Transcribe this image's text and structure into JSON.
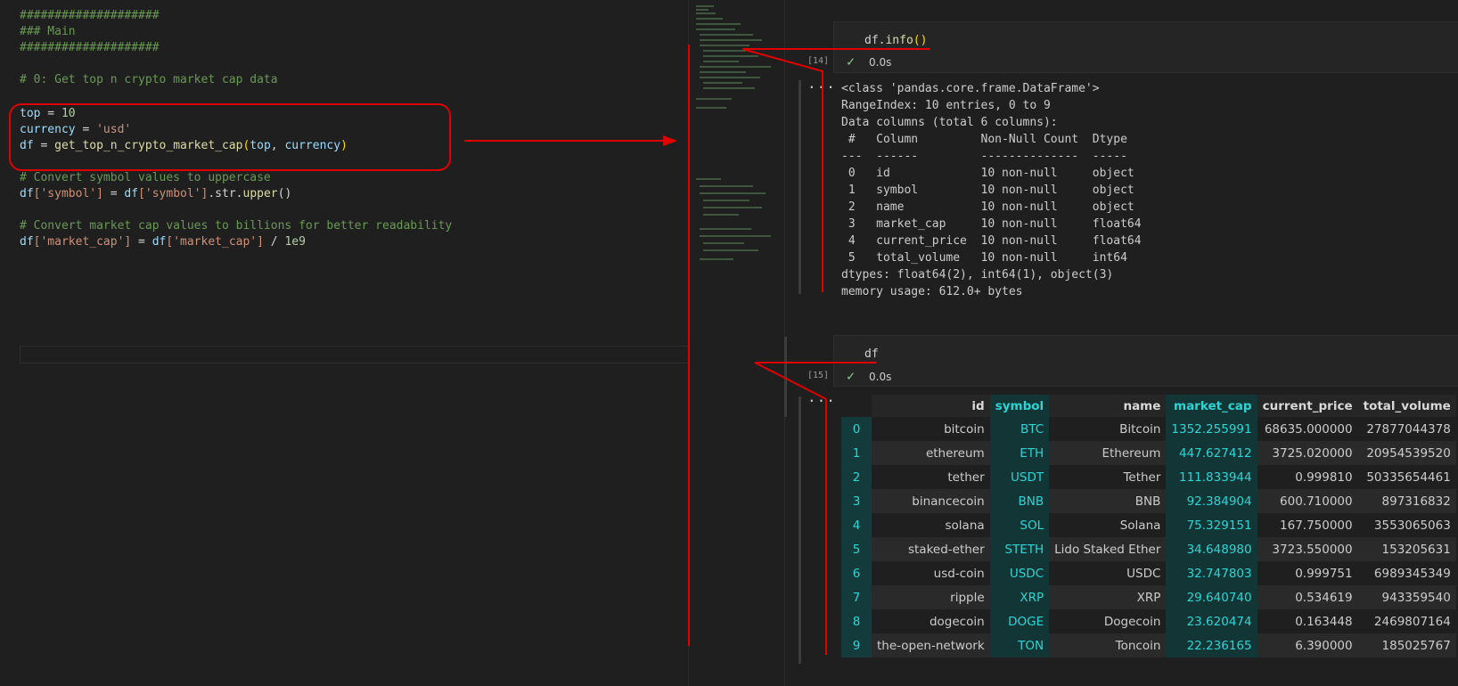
{
  "editor": {
    "lines": {
      "hash1": "####################",
      "main": "### Main",
      "hash2": "####################",
      "c0": "# 0: Get top n crypto market cap data",
      "top_var": "top",
      "top_eq": " = ",
      "top_val": "10",
      "cur_var": "currency",
      "cur_eq": " = ",
      "cur_val": "'usd'",
      "df_var": "df",
      "df_eq": " = ",
      "df_fn": "get_top_n_crypto_market_cap",
      "df_args_open": "(",
      "df_arg1": "top",
      "df_sep": ", ",
      "df_arg2": "currency",
      "df_args_close": ")",
      "c1": "# Convert symbol values to uppercase",
      "l1_a": "df",
      "l1_b": "['symbol']",
      "l1_c": " = ",
      "l1_d": "df",
      "l1_e": "['symbol']",
      "l1_f": ".str.",
      "l1_g": "upper",
      "l1_h": "()",
      "c2": "# Convert market cap values to billions for better readability",
      "l2_a": "df",
      "l2_b": "['market_cap']",
      "l2_c": " = ",
      "l2_d": "df",
      "l2_e": "['market_cap']",
      "l2_f": " / ",
      "l2_g": "1e9"
    }
  },
  "notebook": {
    "cell14": {
      "code_a": "df.",
      "code_b": "info",
      "code_c": "()",
      "exec": "[14]",
      "time": "0.0s",
      "ellipsis": "...",
      "output": "<class 'pandas.core.frame.DataFrame'>\nRangeIndex: 10 entries, 0 to 9\nData columns (total 6 columns):\n #   Column         Non-Null Count  Dtype  \n---  ------         --------------  -----  \n 0   id             10 non-null     object \n 1   symbol         10 non-null     object \n 2   name           10 non-null     object \n 3   market_cap     10 non-null     float64\n 4   current_price  10 non-null     float64\n 5   total_volume   10 non-null     int64  \ndtypes: float64(2), int64(1), object(3)\nmemory usage: 612.0+ bytes"
    },
    "cell15": {
      "code": "df",
      "exec": "[15]",
      "time": "0.0s",
      "ellipsis": "..."
    },
    "table": {
      "columns": [
        "id",
        "symbol",
        "name",
        "market_cap",
        "current_price",
        "total_volume"
      ],
      "rows": [
        [
          "0",
          "bitcoin",
          "BTC",
          "Bitcoin",
          "1352.255991",
          "68635.000000",
          "27877044378"
        ],
        [
          "1",
          "ethereum",
          "ETH",
          "Ethereum",
          "447.627412",
          "3725.020000",
          "20954539520"
        ],
        [
          "2",
          "tether",
          "USDT",
          "Tether",
          "111.833944",
          "0.999810",
          "50335654461"
        ],
        [
          "3",
          "binancecoin",
          "BNB",
          "BNB",
          "92.384904",
          "600.710000",
          "897316832"
        ],
        [
          "4",
          "solana",
          "SOL",
          "Solana",
          "75.329151",
          "167.750000",
          "3553065063"
        ],
        [
          "5",
          "staked-ether",
          "STETH",
          "Lido Staked Ether",
          "34.648980",
          "3723.550000",
          "153205631"
        ],
        [
          "6",
          "usd-coin",
          "USDC",
          "USDC",
          "32.747803",
          "0.999751",
          "6989345349"
        ],
        [
          "7",
          "ripple",
          "XRP",
          "XRP",
          "29.640740",
          "0.534619",
          "943359540"
        ],
        [
          "8",
          "dogecoin",
          "DOGE",
          "Dogecoin",
          "23.620474",
          "0.163448",
          "2469807164"
        ],
        [
          "9",
          "the-open-network",
          "TON",
          "Toncoin",
          "22.236165",
          "6.390000",
          "185025767"
        ]
      ]
    }
  },
  "colors": {
    "annotation_red": "#e00000",
    "highlight_teal": "#2ed4d4",
    "comment_green": "#6a9955"
  }
}
